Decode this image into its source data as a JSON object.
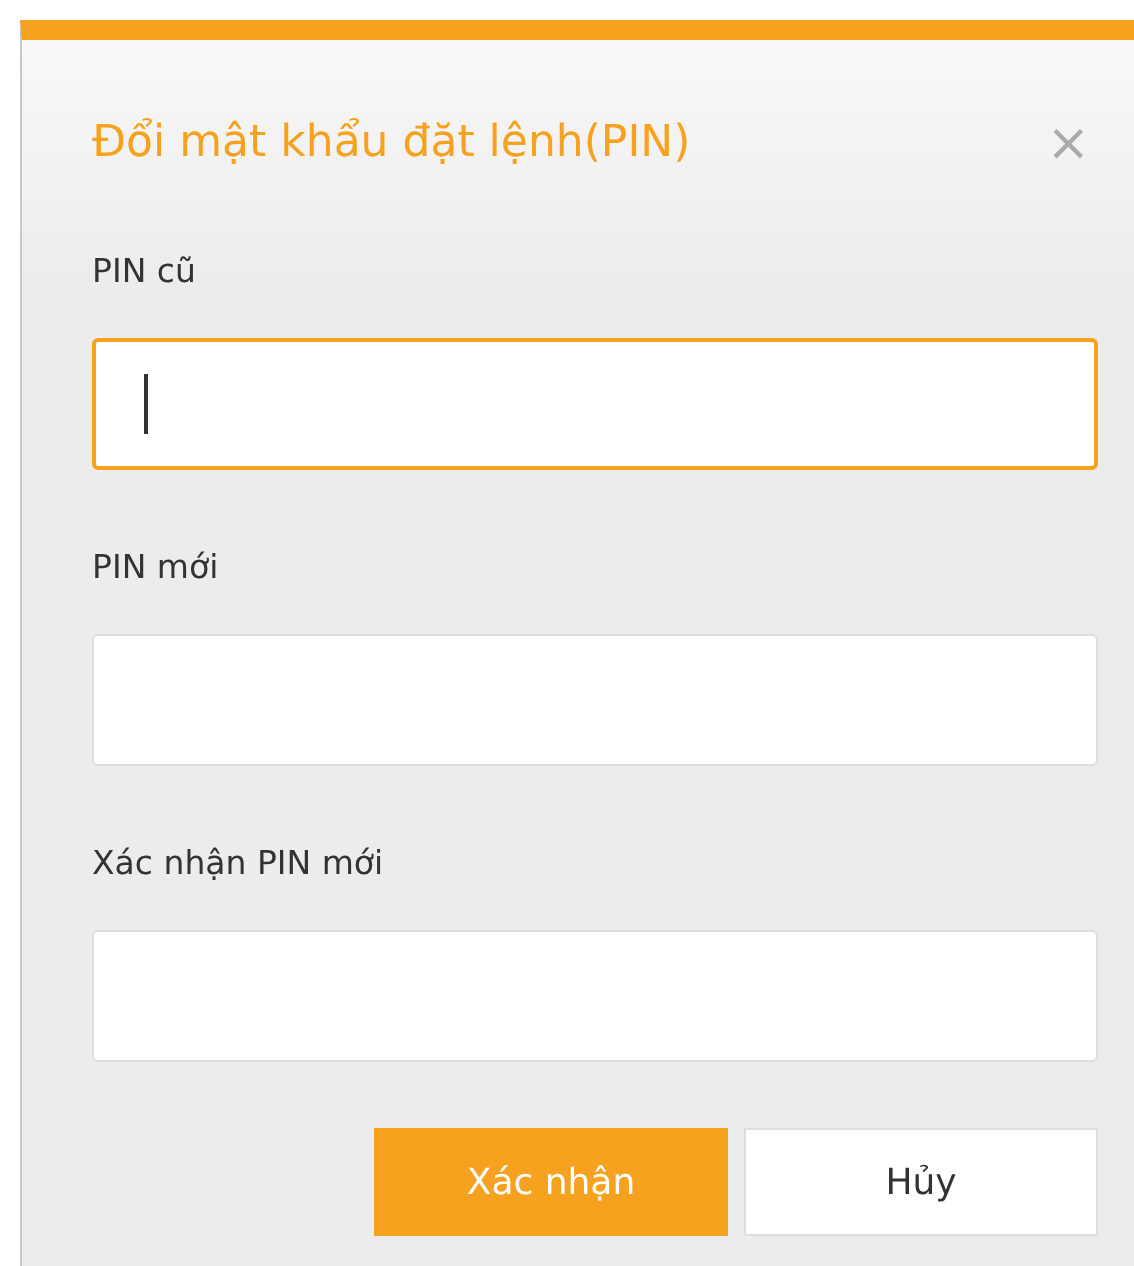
{
  "dialog": {
    "title": "Đổi mật khẩu đặt lệnh(PIN)",
    "close": "×"
  },
  "fields": [
    {
      "label": "PIN cũ",
      "focused": true
    },
    {
      "label": "PIN mới",
      "focused": false
    },
    {
      "label": "Xác nhận PIN mới",
      "focused": false
    }
  ],
  "buttons": [
    {
      "label": "Xác nhận",
      "kind": "primary"
    },
    {
      "label": "Hủy",
      "kind": "secondary"
    }
  ]
}
